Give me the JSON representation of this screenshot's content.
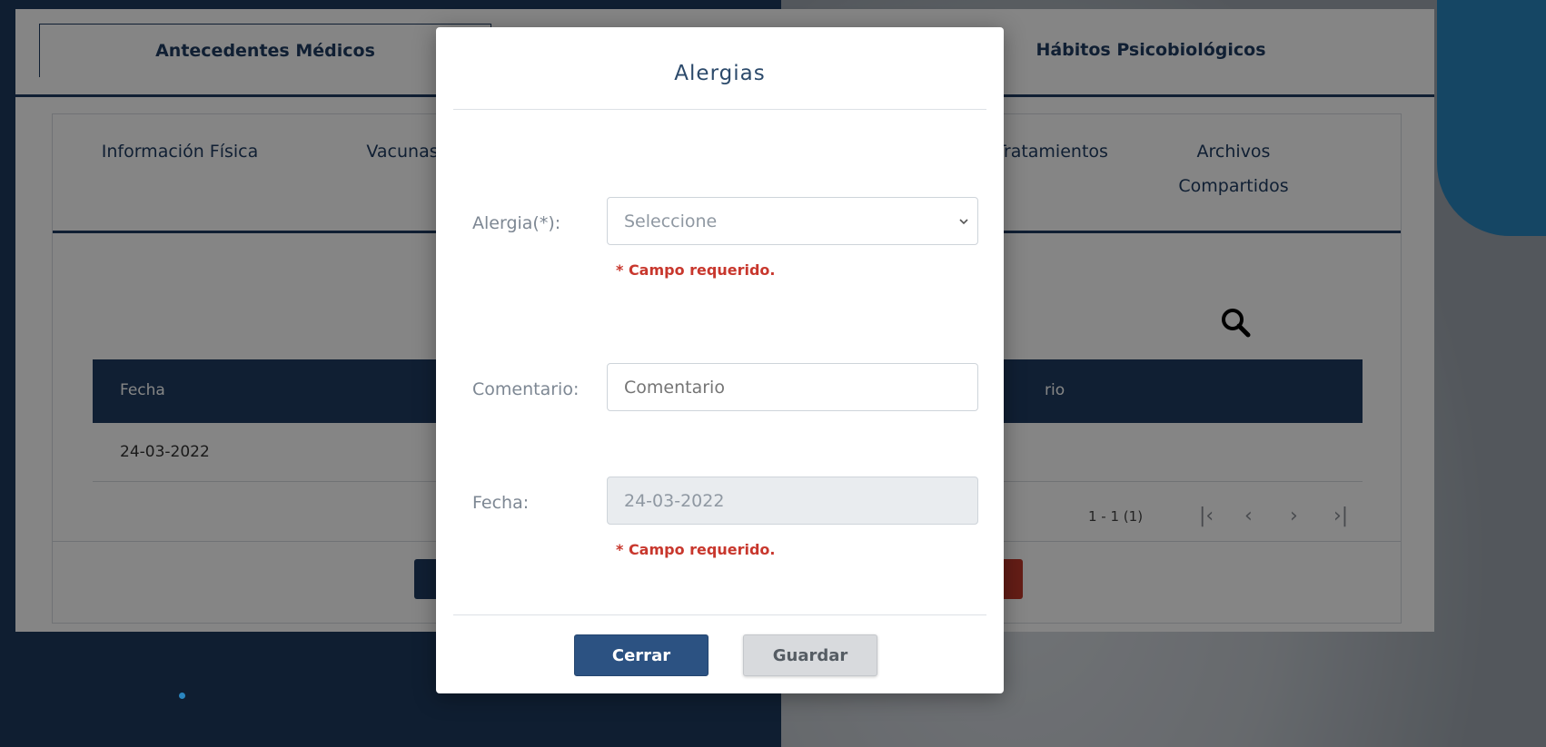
{
  "background": {
    "top_tabs": [
      {
        "label": "Antecedentes Médicos",
        "active": true
      },
      {
        "label": "Hábitos Psicobiológicos",
        "active": false
      }
    ],
    "sub_tabs": [
      {
        "label": "Información Física"
      },
      {
        "label": "Vacunas"
      },
      {
        "label": "Tratamientos"
      },
      {
        "label": "Archivos Compartidos"
      }
    ],
    "table": {
      "headers": [
        "Fecha",
        "rio"
      ],
      "rows": [
        [
          "24-03-2022"
        ]
      ]
    },
    "pager": {
      "range": "1 - 1 (1)"
    }
  },
  "modal": {
    "title": "Alergias",
    "fields": {
      "alergia": {
        "label": "Alergia(*):",
        "value": "Seleccione",
        "error": "* Campo requerido."
      },
      "comentario": {
        "label": "Comentario:",
        "placeholder": "Comentario"
      },
      "fecha": {
        "label": "Fecha:",
        "value": "24-03-2022",
        "error": "* Campo requerido."
      }
    },
    "buttons": {
      "close": "Cerrar",
      "save": "Guardar"
    }
  },
  "colors": {
    "primary": "#1f3d63",
    "error": "#c8372d",
    "accent": "#2a86c0"
  }
}
